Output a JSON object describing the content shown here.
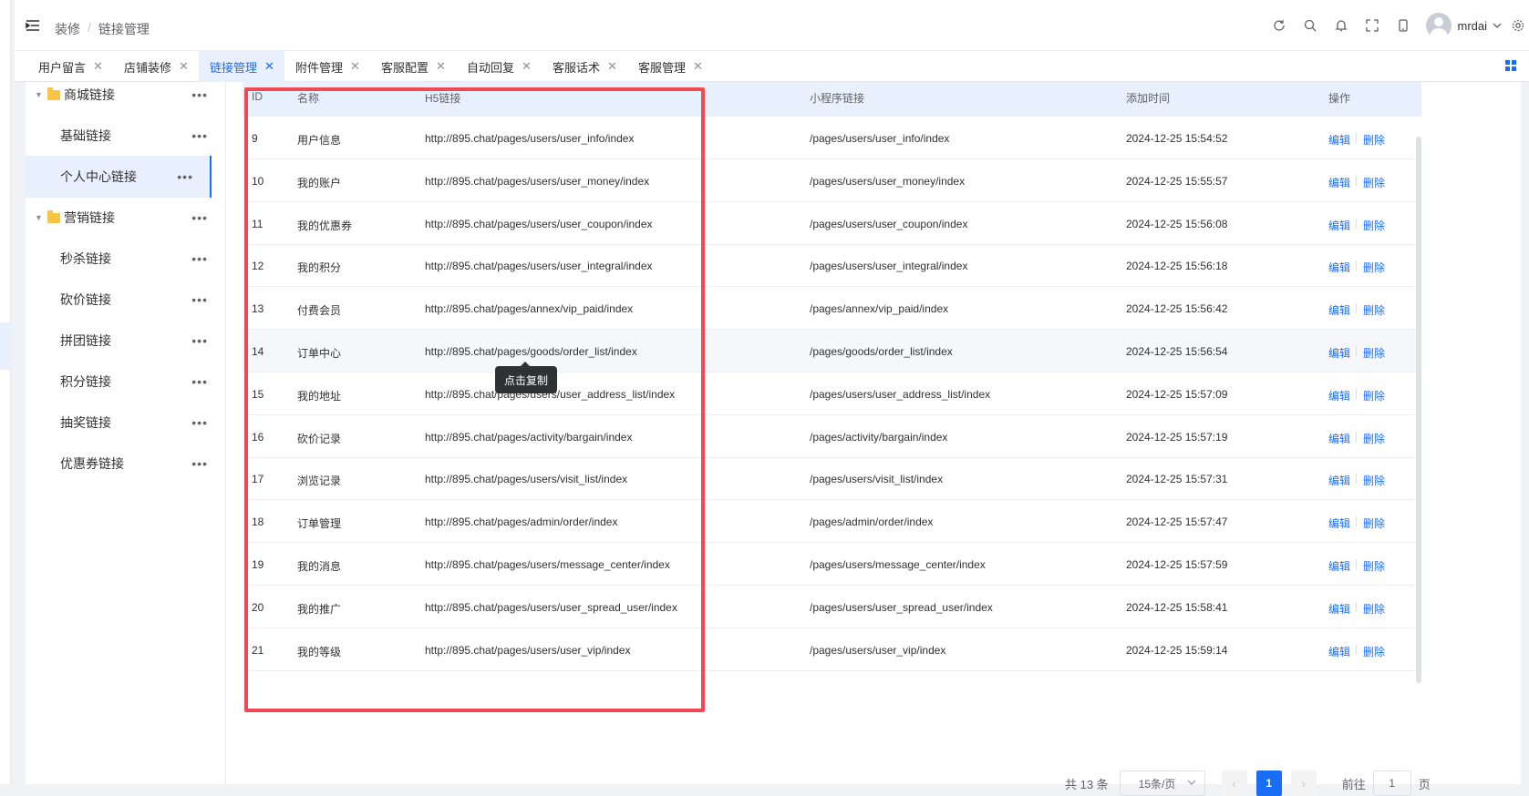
{
  "breadcrumb": [
    "装修",
    "链接管理"
  ],
  "header": {
    "username": "mrdai",
    "icons": [
      "refresh-icon",
      "search-icon",
      "bell-icon",
      "fullscreen-icon",
      "mobile-icon",
      "settings-icon"
    ]
  },
  "tabs": [
    {
      "label": "用户留言",
      "active": false
    },
    {
      "label": "店铺装修",
      "active": false
    },
    {
      "label": "链接管理",
      "active": true
    },
    {
      "label": "附件管理",
      "active": false
    },
    {
      "label": "客服配置",
      "active": false
    },
    {
      "label": "自动回复",
      "active": false
    },
    {
      "label": "客服话术",
      "active": false
    },
    {
      "label": "客服管理",
      "active": false
    }
  ],
  "tree": [
    {
      "label": "商城链接",
      "level": 0,
      "folder": true
    },
    {
      "label": "基础链接",
      "level": 1
    },
    {
      "label": "个人中心链接",
      "level": 1,
      "active": true
    },
    {
      "label": "营销链接",
      "level": 0,
      "folder": true
    },
    {
      "label": "秒杀链接",
      "level": 1
    },
    {
      "label": "砍价链接",
      "level": 1
    },
    {
      "label": "拼团链接",
      "level": 1
    },
    {
      "label": "积分链接",
      "level": 1
    },
    {
      "label": "抽奖链接",
      "level": 1
    },
    {
      "label": "优惠券链接",
      "level": 1
    }
  ],
  "table": {
    "columns": [
      "ID",
      "名称",
      "H5链接",
      "小程序链接",
      "添加时间",
      "操作"
    ],
    "edit_label": "编辑",
    "delete_label": "删除",
    "rows": [
      {
        "id": "9",
        "name": "用户信息",
        "h5": "http://895.chat/pages/users/user_info/index",
        "mini": "/pages/users/user_info/index",
        "time": "2024-12-25 15:54:52"
      },
      {
        "id": "10",
        "name": "我的账户",
        "h5": "http://895.chat/pages/users/user_money/index",
        "mini": "/pages/users/user_money/index",
        "time": "2024-12-25 15:55:57"
      },
      {
        "id": "11",
        "name": "我的优惠券",
        "h5": "http://895.chat/pages/users/user_coupon/index",
        "mini": "/pages/users/user_coupon/index",
        "time": "2024-12-25 15:56:08"
      },
      {
        "id": "12",
        "name": "我的积分",
        "h5": "http://895.chat/pages/users/user_integral/index",
        "mini": "/pages/users/user_integral/index",
        "time": "2024-12-25 15:56:18"
      },
      {
        "id": "13",
        "name": "付费会员",
        "h5": "http://895.chat/pages/annex/vip_paid/index",
        "mini": "/pages/annex/vip_paid/index",
        "time": "2024-12-25 15:56:42"
      },
      {
        "id": "14",
        "name": "订单中心",
        "h5": "http://895.chat/pages/goods/order_list/index",
        "mini": "/pages/goods/order_list/index",
        "time": "2024-12-25 15:56:54"
      },
      {
        "id": "15",
        "name": "我的地址",
        "h5": "http://895.chat/pages/users/user_address_list/index",
        "mini": "/pages/users/user_address_list/index",
        "time": "2024-12-25 15:57:09"
      },
      {
        "id": "16",
        "name": "砍价记录",
        "h5": "http://895.chat/pages/activity/bargain/index",
        "mini": "/pages/activity/bargain/index",
        "time": "2024-12-25 15:57:19"
      },
      {
        "id": "17",
        "name": "浏览记录",
        "h5": "http://895.chat/pages/users/visit_list/index",
        "mini": "/pages/users/visit_list/index",
        "time": "2024-12-25 15:57:31"
      },
      {
        "id": "18",
        "name": "订单管理",
        "h5": "http://895.chat/pages/admin/order/index",
        "mini": "/pages/admin/order/index",
        "time": "2024-12-25 15:57:47"
      },
      {
        "id": "19",
        "name": "我的消息",
        "h5": "http://895.chat/pages/users/message_center/index",
        "mini": "/pages/users/message_center/index",
        "time": "2024-12-25 15:57:59"
      },
      {
        "id": "20",
        "name": "我的推广",
        "h5": "http://895.chat/pages/users/user_spread_user/index",
        "mini": "/pages/users/user_spread_user/index",
        "time": "2024-12-25 15:58:41"
      },
      {
        "id": "21",
        "name": "我的等级",
        "h5": "http://895.chat/pages/users/user_vip/index",
        "mini": "/pages/users/user_vip/index",
        "time": "2024-12-25 15:59:14"
      }
    ]
  },
  "tooltip": "点击复制",
  "pagination": {
    "total": "共 13 条",
    "page_size": "15条/页",
    "current": "1",
    "goto_label": "前往",
    "goto_value": "1",
    "page_suffix": "页"
  },
  "colors": {
    "accent": "#1a6ef5",
    "highlight_box": "#ef4a52",
    "header_bg": "#e8f0fe"
  }
}
